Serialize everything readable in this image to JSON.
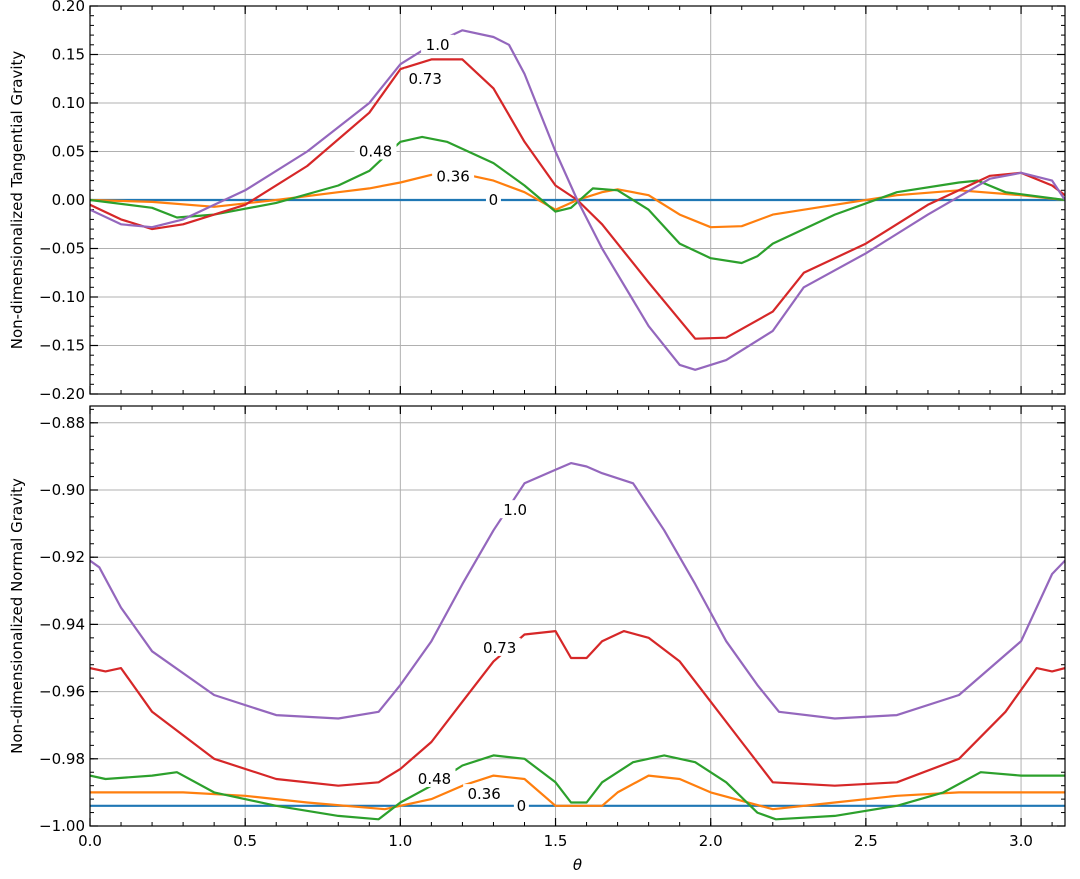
{
  "chart_data": [
    {
      "type": "line",
      "ylabel": "Non-dimensionalized Tangential Gravity",
      "xlabel": "",
      "xlim": [
        0,
        3.1416
      ],
      "ylim": [
        -0.2,
        0.2
      ],
      "xticks": [
        0.0,
        0.5,
        1.0,
        1.5,
        2.0,
        2.5,
        3.0
      ],
      "yticks": [
        -0.2,
        -0.15,
        -0.1,
        -0.05,
        0.0,
        0.05,
        0.1,
        0.15,
        0.2
      ],
      "ytick_labels": [
        "−0.20",
        "−0.15",
        "−0.10",
        "−0.05",
        "0.00",
        "0.05",
        "0.10",
        "0.15",
        "0.20"
      ],
      "grid": true,
      "series": [
        {
          "name": "0",
          "color": "#1f77b4",
          "points": [
            [
              0,
              0
            ],
            [
              3.1416,
              0
            ]
          ]
        },
        {
          "name": "0.36",
          "color": "#ff7f0e",
          "points": [
            [
              0,
              0
            ],
            [
              0.2,
              -0.002
            ],
            [
              0.4,
              -0.007
            ],
            [
              0.6,
              0.0
            ],
            [
              0.8,
              0.008
            ],
            [
              0.9,
              0.012
            ],
            [
              1.0,
              0.018
            ],
            [
              1.1,
              0.026
            ],
            [
              1.2,
              0.027
            ],
            [
              1.3,
              0.02
            ],
            [
              1.4,
              0.008
            ],
            [
              1.5,
              -0.01
            ],
            [
              1.57,
              0.0
            ],
            [
              1.65,
              0.008
            ],
            [
              1.7,
              0.011
            ],
            [
              1.8,
              0.005
            ],
            [
              1.9,
              -0.015
            ],
            [
              2.0,
              -0.028
            ],
            [
              2.1,
              -0.027
            ],
            [
              2.2,
              -0.015
            ],
            [
              2.4,
              -0.005
            ],
            [
              2.6,
              0.005
            ],
            [
              2.8,
              0.01
            ],
            [
              3.0,
              0.005
            ],
            [
              3.1416,
              0.0
            ]
          ]
        },
        {
          "name": "0.48",
          "color": "#2ca02c",
          "points": [
            [
              0,
              0
            ],
            [
              0.2,
              -0.008
            ],
            [
              0.28,
              -0.018
            ],
            [
              0.4,
              -0.015
            ],
            [
              0.6,
              -0.003
            ],
            [
              0.8,
              0.015
            ],
            [
              0.9,
              0.03
            ],
            [
              1.0,
              0.06
            ],
            [
              1.07,
              0.065
            ],
            [
              1.15,
              0.06
            ],
            [
              1.3,
              0.038
            ],
            [
              1.4,
              0.015
            ],
            [
              1.5,
              -0.012
            ],
            [
              1.55,
              -0.008
            ],
            [
              1.62,
              0.012
            ],
            [
              1.7,
              0.01
            ],
            [
              1.8,
              -0.01
            ],
            [
              1.9,
              -0.045
            ],
            [
              2.0,
              -0.06
            ],
            [
              2.1,
              -0.065
            ],
            [
              2.15,
              -0.058
            ],
            [
              2.2,
              -0.045
            ],
            [
              2.4,
              -0.015
            ],
            [
              2.6,
              0.008
            ],
            [
              2.8,
              0.018
            ],
            [
              2.86,
              0.02
            ],
            [
              2.95,
              0.008
            ],
            [
              3.1416,
              0.0
            ]
          ]
        },
        {
          "name": "0.73",
          "color": "#d62728",
          "points": [
            [
              0,
              -0.005
            ],
            [
              0.1,
              -0.02
            ],
            [
              0.2,
              -0.03
            ],
            [
              0.3,
              -0.025
            ],
            [
              0.5,
              -0.005
            ],
            [
              0.7,
              0.035
            ],
            [
              0.9,
              0.09
            ],
            [
              1.0,
              0.135
            ],
            [
              1.1,
              0.145
            ],
            [
              1.2,
              0.145
            ],
            [
              1.3,
              0.115
            ],
            [
              1.4,
              0.06
            ],
            [
              1.5,
              0.015
            ],
            [
              1.57,
              0.0
            ],
            [
              1.65,
              -0.025
            ],
            [
              1.8,
              -0.085
            ],
            [
              1.95,
              -0.143
            ],
            [
              2.05,
              -0.142
            ],
            [
              2.2,
              -0.115
            ],
            [
              2.3,
              -0.075
            ],
            [
              2.5,
              -0.045
            ],
            [
              2.7,
              -0.005
            ],
            [
              2.9,
              0.025
            ],
            [
              3.0,
              0.028
            ],
            [
              3.1,
              0.015
            ],
            [
              3.1416,
              0.005
            ]
          ]
        },
        {
          "name": "1.0",
          "color": "#9467bd",
          "points": [
            [
              0,
              -0.01
            ],
            [
              0.1,
              -0.025
            ],
            [
              0.2,
              -0.028
            ],
            [
              0.3,
              -0.02
            ],
            [
              0.5,
              0.01
            ],
            [
              0.7,
              0.05
            ],
            [
              0.9,
              0.1
            ],
            [
              1.0,
              0.14
            ],
            [
              1.1,
              0.16
            ],
            [
              1.2,
              0.175
            ],
            [
              1.3,
              0.168
            ],
            [
              1.35,
              0.16
            ],
            [
              1.4,
              0.13
            ],
            [
              1.5,
              0.05
            ],
            [
              1.57,
              0.0
            ],
            [
              1.65,
              -0.05
            ],
            [
              1.8,
              -0.13
            ],
            [
              1.9,
              -0.17
            ],
            [
              1.95,
              -0.175
            ],
            [
              2.05,
              -0.165
            ],
            [
              2.2,
              -0.135
            ],
            [
              2.3,
              -0.09
            ],
            [
              2.5,
              -0.055
            ],
            [
              2.7,
              -0.015
            ],
            [
              2.9,
              0.022
            ],
            [
              3.0,
              0.028
            ],
            [
              3.1,
              0.02
            ],
            [
              3.1416,
              0.0
            ]
          ]
        }
      ],
      "annotations": [
        {
          "text": "1.0",
          "x": 1.12,
          "y": 0.16
        },
        {
          "text": "0.73",
          "x": 1.08,
          "y": 0.125
        },
        {
          "text": "0.48",
          "x": 0.92,
          "y": 0.05
        },
        {
          "text": "0.36",
          "x": 1.17,
          "y": 0.024
        },
        {
          "text": "0",
          "x": 1.3,
          "y": 0.0
        }
      ]
    },
    {
      "type": "line",
      "ylabel": "Non-dimensionalized Normal Gravity",
      "xlabel": "θ",
      "xlim": [
        0,
        3.1416
      ],
      "ylim": [
        -1.0,
        -0.875
      ],
      "xticks": [
        0.0,
        0.5,
        1.0,
        1.5,
        2.0,
        2.5,
        3.0
      ],
      "xtick_labels": [
        "0.0",
        "0.5",
        "1.0",
        "1.5",
        "2.0",
        "2.5",
        "3.0"
      ],
      "yticks": [
        -1.0,
        -0.98,
        -0.96,
        -0.94,
        -0.92,
        -0.9,
        -0.88
      ],
      "ytick_labels": [
        "−1.00",
        "−0.98",
        "−0.96",
        "−0.94",
        "−0.92",
        "−0.90",
        "−0.88"
      ],
      "grid": true,
      "series": [
        {
          "name": "0",
          "color": "#1f77b4",
          "points": [
            [
              0,
              -0.994
            ],
            [
              3.1416,
              -0.994
            ]
          ]
        },
        {
          "name": "0.36",
          "color": "#ff7f0e",
          "points": [
            [
              0,
              -0.99
            ],
            [
              0.3,
              -0.99
            ],
            [
              0.5,
              -0.991
            ],
            [
              0.7,
              -0.993
            ],
            [
              0.95,
              -0.995
            ],
            [
              1.1,
              -0.992
            ],
            [
              1.2,
              -0.988
            ],
            [
              1.3,
              -0.985
            ],
            [
              1.4,
              -0.986
            ],
            [
              1.5,
              -0.994
            ],
            [
              1.57,
              -0.994
            ],
            [
              1.65,
              -0.994
            ],
            [
              1.7,
              -0.99
            ],
            [
              1.8,
              -0.985
            ],
            [
              1.9,
              -0.986
            ],
            [
              2.0,
              -0.99
            ],
            [
              2.2,
              -0.995
            ],
            [
              2.4,
              -0.993
            ],
            [
              2.6,
              -0.991
            ],
            [
              2.8,
              -0.99
            ],
            [
              3.0,
              -0.99
            ],
            [
              3.1416,
              -0.99
            ]
          ]
        },
        {
          "name": "0.48",
          "color": "#2ca02c",
          "points": [
            [
              0,
              -0.985
            ],
            [
              0.05,
              -0.986
            ],
            [
              0.2,
              -0.985
            ],
            [
              0.28,
              -0.984
            ],
            [
              0.4,
              -0.99
            ],
            [
              0.6,
              -0.994
            ],
            [
              0.8,
              -0.997
            ],
            [
              0.93,
              -0.998
            ],
            [
              1.0,
              -0.993
            ],
            [
              1.1,
              -0.988
            ],
            [
              1.2,
              -0.982
            ],
            [
              1.3,
              -0.979
            ],
            [
              1.4,
              -0.98
            ],
            [
              1.5,
              -0.987
            ],
            [
              1.55,
              -0.993
            ],
            [
              1.6,
              -0.993
            ],
            [
              1.65,
              -0.987
            ],
            [
              1.75,
              -0.981
            ],
            [
              1.85,
              -0.979
            ],
            [
              1.95,
              -0.981
            ],
            [
              2.05,
              -0.987
            ],
            [
              2.15,
              -0.996
            ],
            [
              2.21,
              -0.998
            ],
            [
              2.4,
              -0.997
            ],
            [
              2.6,
              -0.994
            ],
            [
              2.75,
              -0.99
            ],
            [
              2.87,
              -0.984
            ],
            [
              3.0,
              -0.985
            ],
            [
              3.1416,
              -0.985
            ]
          ]
        },
        {
          "name": "0.73",
          "color": "#d62728",
          "points": [
            [
              0,
              -0.953
            ],
            [
              0.05,
              -0.954
            ],
            [
              0.1,
              -0.953
            ],
            [
              0.2,
              -0.966
            ],
            [
              0.4,
              -0.98
            ],
            [
              0.6,
              -0.986
            ],
            [
              0.8,
              -0.988
            ],
            [
              0.93,
              -0.987
            ],
            [
              1.0,
              -0.983
            ],
            [
              1.1,
              -0.975
            ],
            [
              1.2,
              -0.963
            ],
            [
              1.3,
              -0.951
            ],
            [
              1.4,
              -0.943
            ],
            [
              1.5,
              -0.942
            ],
            [
              1.55,
              -0.95
            ],
            [
              1.6,
              -0.95
            ],
            [
              1.65,
              -0.945
            ],
            [
              1.72,
              -0.942
            ],
            [
              1.8,
              -0.944
            ],
            [
              1.9,
              -0.951
            ],
            [
              2.0,
              -0.963
            ],
            [
              2.1,
              -0.975
            ],
            [
              2.2,
              -0.987
            ],
            [
              2.4,
              -0.988
            ],
            [
              2.6,
              -0.987
            ],
            [
              2.8,
              -0.98
            ],
            [
              2.95,
              -0.966
            ],
            [
              3.05,
              -0.953
            ],
            [
              3.1,
              -0.954
            ],
            [
              3.1416,
              -0.953
            ]
          ]
        },
        {
          "name": "1.0",
          "color": "#9467bd",
          "points": [
            [
              0,
              -0.921
            ],
            [
              0.03,
              -0.923
            ],
            [
              0.1,
              -0.935
            ],
            [
              0.2,
              -0.948
            ],
            [
              0.4,
              -0.961
            ],
            [
              0.6,
              -0.967
            ],
            [
              0.8,
              -0.968
            ],
            [
              0.93,
              -0.966
            ],
            [
              1.0,
              -0.958
            ],
            [
              1.1,
              -0.945
            ],
            [
              1.2,
              -0.928
            ],
            [
              1.3,
              -0.912
            ],
            [
              1.4,
              -0.898
            ],
            [
              1.5,
              -0.894
            ],
            [
              1.55,
              -0.892
            ],
            [
              1.6,
              -0.893
            ],
            [
              1.65,
              -0.895
            ],
            [
              1.75,
              -0.898
            ],
            [
              1.85,
              -0.912
            ],
            [
              1.95,
              -0.928
            ],
            [
              2.05,
              -0.945
            ],
            [
              2.15,
              -0.958
            ],
            [
              2.22,
              -0.966
            ],
            [
              2.4,
              -0.968
            ],
            [
              2.6,
              -0.967
            ],
            [
              2.8,
              -0.961
            ],
            [
              3.0,
              -0.945
            ],
            [
              3.1,
              -0.925
            ],
            [
              3.1416,
              -0.921
            ]
          ]
        }
      ],
      "annotations": [
        {
          "text": "1.0",
          "x": 1.37,
          "y": -0.906
        },
        {
          "text": "0.73",
          "x": 1.32,
          "y": -0.947
        },
        {
          "text": "0.48",
          "x": 1.11,
          "y": -0.986
        },
        {
          "text": "0.36",
          "x": 1.27,
          "y": -0.9905
        },
        {
          "text": "0",
          "x": 1.39,
          "y": -0.994
        }
      ]
    }
  ]
}
